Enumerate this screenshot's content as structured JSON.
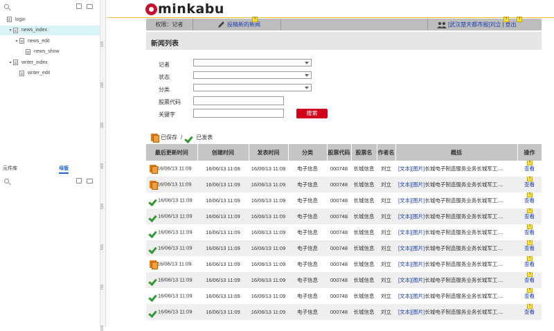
{
  "left_panel": {
    "pages": [
      {
        "label": "login",
        "indent": 0,
        "caret": "",
        "selected": false
      },
      {
        "label": "news_index",
        "indent": 1,
        "caret": "▾",
        "selected": true
      },
      {
        "label": "news_edit",
        "indent": 2,
        "caret": "▾",
        "selected": false
      },
      {
        "label": "news_show",
        "indent": 3,
        "caret": "",
        "selected": false
      },
      {
        "label": "writer_index",
        "indent": 1,
        "caret": "▾",
        "selected": false
      },
      {
        "label": "writer_edit",
        "indent": 2,
        "caret": "",
        "selected": false
      }
    ],
    "tab_library": "元件库",
    "tab_masters": "母版"
  },
  "ruler_ticks": [
    "100",
    "200",
    "300",
    "400",
    "500",
    "600",
    "700",
    "800"
  ],
  "header": {
    "logo_text": "minkabu",
    "role_label": "权限：记者",
    "post_news_link": "投稿新的新闻",
    "user_link": "[武汉楚天都市报]刘立",
    "separator": "|",
    "logout_link": "登出",
    "pin_marker": "?"
  },
  "page_title": "新闻列表",
  "search_form": {
    "reporter_label": "记者",
    "status_label": "状态",
    "category_label": "分类",
    "stock_code_label": "股票代码",
    "keyword_label": "关键字",
    "search_button": "搜索"
  },
  "legend": {
    "saved_label": "已保存",
    "separator": "/",
    "published_label": "已发表"
  },
  "table": {
    "columns": [
      "最后更新时间",
      "创建时间",
      "发表时间",
      "分类",
      "股票代码",
      "股票名",
      "作者名",
      "概括",
      "操作"
    ],
    "rows": [
      {
        "status": "saved",
        "updated": "16/06/13 11:09",
        "created": "16/06/13 11:09",
        "published": "16/06/13 11:09",
        "category": "电子信息",
        "code": "000748",
        "name": "长城信息",
        "author": "刘立",
        "summary_tags": "[文本][图片]",
        "summary_text": "长城电子制造服务业务长城军工....",
        "action": "查看"
      },
      {
        "status": "saved",
        "updated": "16/06/13 11:09",
        "created": "16/06/13 11:09",
        "published": "16/06/13 11:09",
        "category": "电子信息",
        "code": "000748",
        "name": "长城信息",
        "author": "刘立",
        "summary_tags": "[文本][图片]",
        "summary_text": "长城电子制造服务业务长城军工....",
        "action": "查看"
      },
      {
        "status": "published",
        "updated": "16/06/13 11:09",
        "created": "16/06/13 11:09",
        "published": "16/06/13 11:09",
        "category": "电子信息",
        "code": "000748",
        "name": "长城信息",
        "author": "刘立",
        "summary_tags": "[文本][图片]",
        "summary_text": "长城电子制造服务业务长城军工....",
        "action": "查看"
      },
      {
        "status": "published",
        "updated": "16/06/13 11:09",
        "created": "16/06/13 11:09",
        "published": "16/06/13 11:09",
        "category": "电子信息",
        "code": "000748",
        "name": "长城信息",
        "author": "刘立",
        "summary_tags": "[文本][图片]",
        "summary_text": "长城电子制造服务业务长城军工....",
        "action": "查看"
      },
      {
        "status": "published",
        "updated": "16/06/13 11:09",
        "created": "16/06/13 11:09",
        "published": "16/06/13 11:09",
        "category": "电子信息",
        "code": "000748",
        "name": "长城信息",
        "author": "刘立",
        "summary_tags": "[文本][图片]",
        "summary_text": "长城电子制造服务业务长城军工....",
        "action": "查看"
      },
      {
        "status": "published",
        "updated": "16/06/13 11:09",
        "created": "16/06/13 11:09",
        "published": "16/06/13 11:09",
        "category": "电子信息",
        "code": "000748",
        "name": "长城信息",
        "author": "刘立",
        "summary_tags": "[文本][图片]",
        "summary_text": "长城电子制造服务业务长城军工....",
        "action": "查看"
      },
      {
        "status": "saved",
        "updated": "16/06/13 11:09",
        "created": "16/06/13 11:09",
        "published": "16/06/13 11:09",
        "category": "电子信息",
        "code": "000748",
        "name": "长城信息",
        "author": "刘立",
        "summary_tags": "[文本][图片]",
        "summary_text": "长城电子制造服务业务长城军工....",
        "action": "查看"
      },
      {
        "status": "published",
        "updated": "16/06/13 11:09",
        "created": "16/06/13 11:09",
        "published": "16/06/13 11:09",
        "category": "电子信息",
        "code": "000748",
        "name": "长城信息",
        "author": "刘立",
        "summary_tags": "[文本][图片]",
        "summary_text": "长城电子制造服务业务长城军工....",
        "action": "查看"
      },
      {
        "status": "published",
        "updated": "16/06/13 11:09",
        "created": "16/06/13 11:09",
        "published": "16/06/13 11:09",
        "category": "电子信息",
        "code": "000748",
        "name": "长城信息",
        "author": "刘立",
        "summary_tags": "[文本][图片]",
        "summary_text": "长城电子制造服务业务长城军工....",
        "action": "查看"
      },
      {
        "status": "published",
        "updated": "16/06/13 11:09",
        "created": "16/06/13 11:09",
        "published": "16/06/13 11:09",
        "category": "电子信息",
        "code": "000748",
        "name": "长城信息",
        "author": "刘立",
        "summary_tags": "[文本][图片]",
        "summary_text": "长城电子制造服务业务长城军工....",
        "action": "查看"
      }
    ]
  },
  "colors": {
    "accent_red": "#d0021b",
    "logo_red": "#c8102e",
    "link_blue": "#1a3faf",
    "navbar_gray": "#bdbdbd",
    "selection_cyan": "#d9f3f7"
  }
}
